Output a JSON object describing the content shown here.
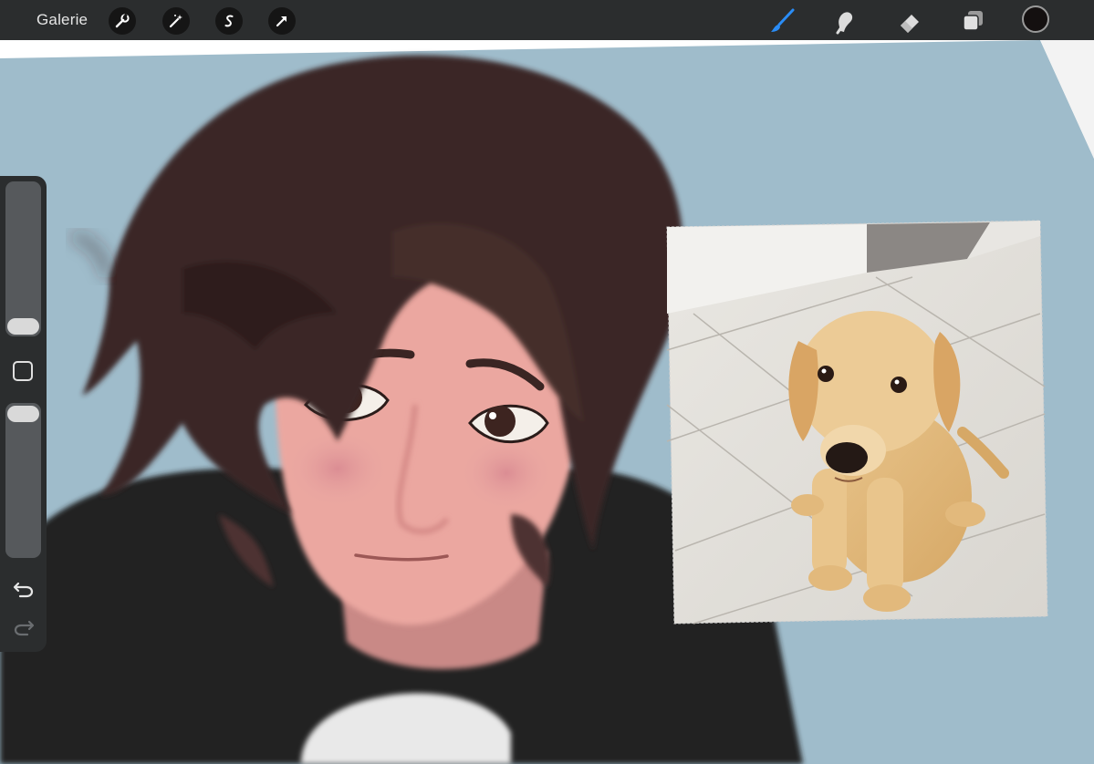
{
  "topbar": {
    "gallery_label": "Galerie",
    "left_tools": [
      {
        "icon": "wrench-icon",
        "label": "actions"
      },
      {
        "icon": "magic-wand-icon",
        "label": "adjustments"
      },
      {
        "icon": "selection-s-icon",
        "label": "selection"
      },
      {
        "icon": "arrow-cursor-icon",
        "label": "transform"
      }
    ],
    "right_tools": [
      {
        "icon": "brush-icon",
        "active": true
      },
      {
        "icon": "smudge-icon",
        "active": false
      },
      {
        "icon": "eraser-icon",
        "active": false
      },
      {
        "icon": "layers-icon",
        "active": false
      }
    ],
    "current_color": "#141010",
    "active_color": "#2a8cf5"
  },
  "sidebar": {
    "size_slider_level": 0.12,
    "opacity_slider_level": 0.98,
    "modify_icon": "square-modify-icon",
    "undo_icon": "undo-arrow-icon",
    "redo_icon": "redo-arrow-icon"
  },
  "canvas": {
    "background_color": "#9fbccb",
    "reference_image": "puppy-photo"
  }
}
